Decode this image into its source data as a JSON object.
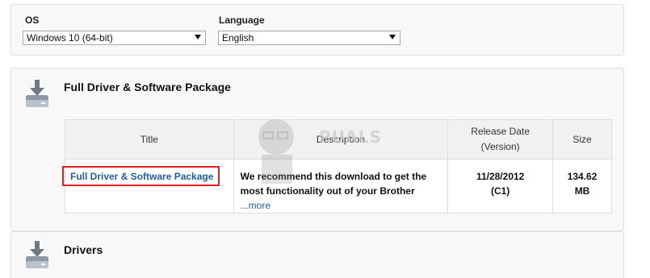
{
  "filters": {
    "os_label": "OS",
    "os_value": "Windows 10 (64-bit)",
    "language_label": "Language",
    "language_value": "English"
  },
  "full_package": {
    "section_title": "Full Driver & Software Package",
    "columns": {
      "title": "Title",
      "description": "Description",
      "release_date_line1": "Release Date",
      "release_date_line2": "(Version)",
      "size": "Size"
    },
    "row": {
      "title_link": "Full Driver & Software Package",
      "description": "We recommend this download to get the most functionality out of your Brother",
      "more_link": "...more",
      "release_date": "11/28/2012",
      "version": "(C1)",
      "size_value": "134.62",
      "size_unit": "MB"
    }
  },
  "drivers": {
    "section_title": "Drivers"
  },
  "watermark": {
    "text": "PUALS"
  },
  "colors": {
    "link": "#1f5fa6",
    "highlight_box": "#e0201b",
    "panel_bg": "#f8f8f8",
    "header_bg": "#f1f1f1"
  },
  "icons": [
    "download-tray-icon",
    "dropdown-arrow-icon"
  ]
}
